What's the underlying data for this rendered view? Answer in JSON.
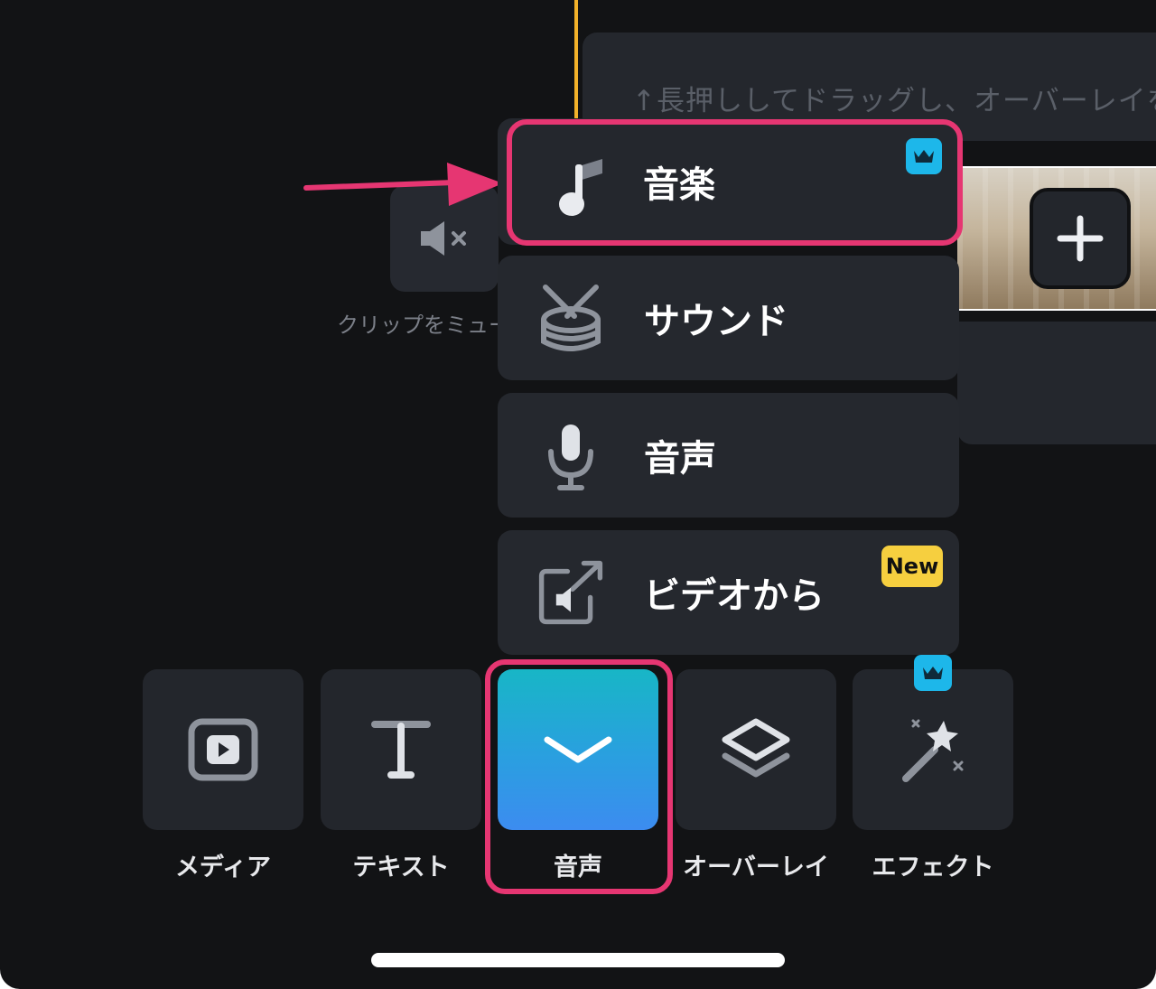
{
  "timeline": {
    "overlay_hint": "↑長押ししてドラッグし、オーバーレイを",
    "mute_clip_label": "クリップをミュート"
  },
  "audio_menu": {
    "items": [
      {
        "label": "音楽",
        "icon": "music-note-icon",
        "badge": "crown"
      },
      {
        "label": "サウンド",
        "icon": "drum-icon"
      },
      {
        "label": "音声",
        "icon": "microphone-icon"
      },
      {
        "label": "ビデオから",
        "icon": "extract-audio-icon",
        "badge": "New"
      }
    ]
  },
  "toolbar": {
    "items": [
      {
        "label": "メディア",
        "icon": "play-box-icon"
      },
      {
        "label": "テキスト",
        "icon": "text-icon"
      },
      {
        "label": "音声",
        "icon": "chevron-down-icon",
        "active": true
      },
      {
        "label": "オーバーレイ",
        "icon": "layers-icon"
      },
      {
        "label": "エフェクト",
        "icon": "magic-wand-icon",
        "badge": "crown"
      }
    ]
  },
  "colors": {
    "background": "#121315",
    "panel": "#24272d",
    "highlight": "#e63672",
    "crown_badge": "#1db7ea",
    "new_badge": "#f6cf3f",
    "playhead": "#f3b22a"
  }
}
